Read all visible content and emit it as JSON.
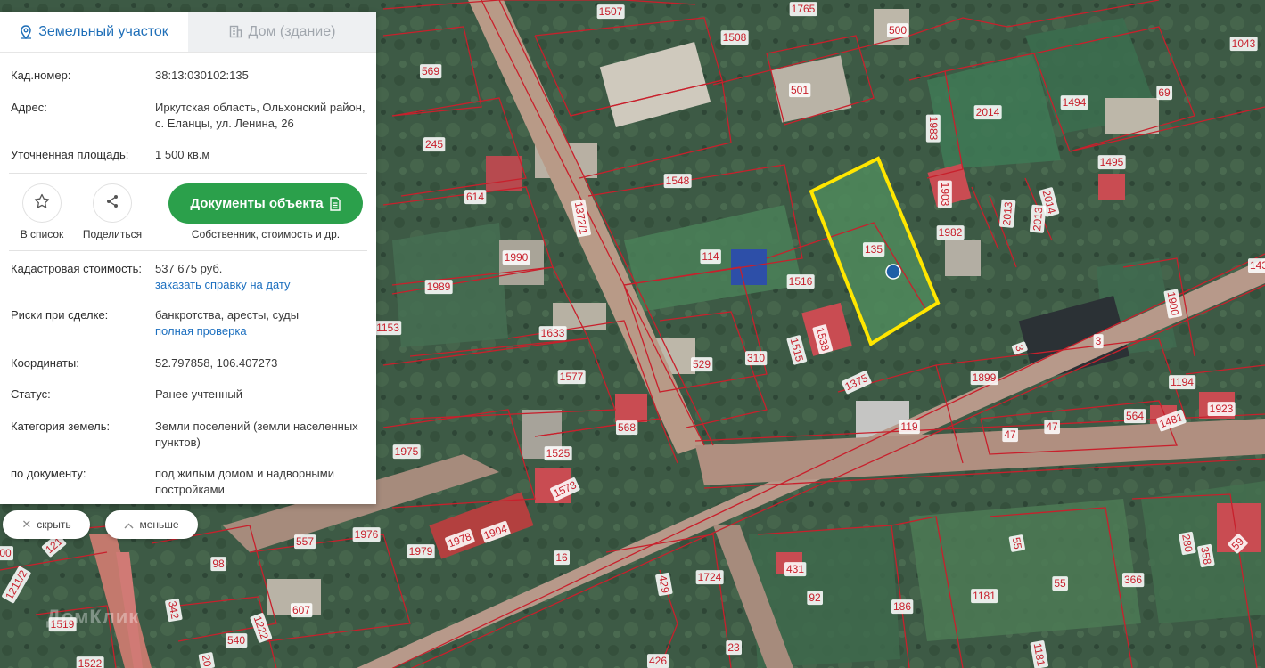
{
  "tabs": [
    {
      "label": "Земельный участок",
      "icon": "map-pin-icon",
      "active": true
    },
    {
      "label": "Дом (здание)",
      "icon": "building-icon",
      "active": false
    }
  ],
  "info": {
    "cad_number": {
      "label": "Кад.номер:",
      "value": "38:13:030102:135"
    },
    "address": {
      "label": "Адрес:",
      "value": "Иркутская область, Ольхонский район, с. Еланцы, ул. Ленина, 26"
    },
    "area": {
      "label": "Уточненная площадь:",
      "value": "1 500 кв.м"
    }
  },
  "actions": {
    "favorite_label": "В список",
    "share_label": "Поделиться",
    "documents_button": "Документы объекта",
    "documents_caption": "Собственник, стоимость и др."
  },
  "details": {
    "cost": {
      "label": "Кадастровая стоимость:",
      "value": "537 675 руб.",
      "link": "заказать справку на дату"
    },
    "risks": {
      "label": "Риски при сделке:",
      "value": "банкротства, аресты, суды",
      "link": "полная проверка"
    },
    "coords": {
      "label": "Координаты:",
      "value": "52.797858, 106.407273"
    },
    "status": {
      "label": "Статус:",
      "value": "Ранее учтенный"
    },
    "category": {
      "label": "Категория земель:",
      "value": "Земли поселений (земли населенных пунктов)"
    },
    "by_document": {
      "label": "по документу:",
      "value": "под жилым домом и надворными постройками"
    }
  },
  "controls": {
    "hide_label": "скрыть",
    "less_label": "меньше"
  },
  "watermark": "ДомКлик",
  "colors": {
    "accent": "#2ba04b",
    "link": "#1c6fbf",
    "parcel_lines": "#c8202c",
    "highlight": "#ffe600"
  },
  "parcels": [
    {
      "text": "1507"
    },
    {
      "text": "1765"
    },
    {
      "text": "500"
    },
    {
      "text": "1043"
    },
    {
      "text": "1508"
    },
    {
      "text": "569"
    },
    {
      "text": "501"
    },
    {
      "text": "2014"
    },
    {
      "text": "1494"
    },
    {
      "text": "69"
    },
    {
      "text": "1983"
    },
    {
      "text": "245"
    },
    {
      "text": "1548"
    },
    {
      "text": "1495"
    },
    {
      "text": "614"
    },
    {
      "text": "1903"
    },
    {
      "text": "2013"
    },
    {
      "text": "2014"
    },
    {
      "text": "2013"
    },
    {
      "text": "1372/1"
    },
    {
      "text": "135"
    },
    {
      "text": "1982"
    },
    {
      "text": "114"
    },
    {
      "text": "1990"
    },
    {
      "text": "143"
    },
    {
      "text": "1989"
    },
    {
      "text": "1516"
    },
    {
      "text": "1900"
    },
    {
      "text": "1153"
    },
    {
      "text": "1633"
    },
    {
      "text": "1538"
    },
    {
      "text": "3"
    },
    {
      "text": "3"
    },
    {
      "text": "529"
    },
    {
      "text": "310"
    },
    {
      "text": "1515"
    },
    {
      "text": "1577"
    },
    {
      "text": "1375"
    },
    {
      "text": "1899"
    },
    {
      "text": "1194"
    },
    {
      "text": "1923"
    },
    {
      "text": "568"
    },
    {
      "text": "119"
    },
    {
      "text": "564"
    },
    {
      "text": "47"
    },
    {
      "text": "47"
    },
    {
      "text": "1481"
    },
    {
      "text": "1975"
    },
    {
      "text": "1525"
    },
    {
      "text": "1573"
    },
    {
      "text": "1976"
    },
    {
      "text": "1978"
    },
    {
      "text": "1904"
    },
    {
      "text": "557"
    },
    {
      "text": "1979"
    },
    {
      "text": "16"
    },
    {
      "text": "280"
    },
    {
      "text": "59"
    },
    {
      "text": "55"
    },
    {
      "text": "358"
    },
    {
      "text": "98"
    },
    {
      "text": "431"
    },
    {
      "text": "1724"
    },
    {
      "text": "429"
    },
    {
      "text": "366"
    },
    {
      "text": "55"
    },
    {
      "text": "92"
    },
    {
      "text": "1181"
    },
    {
      "text": "186"
    },
    {
      "text": "607"
    },
    {
      "text": "342"
    },
    {
      "text": "1519"
    },
    {
      "text": "540"
    },
    {
      "text": "1222"
    },
    {
      "text": "1522"
    },
    {
      "text": "20"
    },
    {
      "text": "426"
    },
    {
      "text": "23"
    },
    {
      "text": "1181"
    },
    {
      "text": "1211/2"
    },
    {
      "text": "121"
    },
    {
      "text": "00"
    }
  ]
}
